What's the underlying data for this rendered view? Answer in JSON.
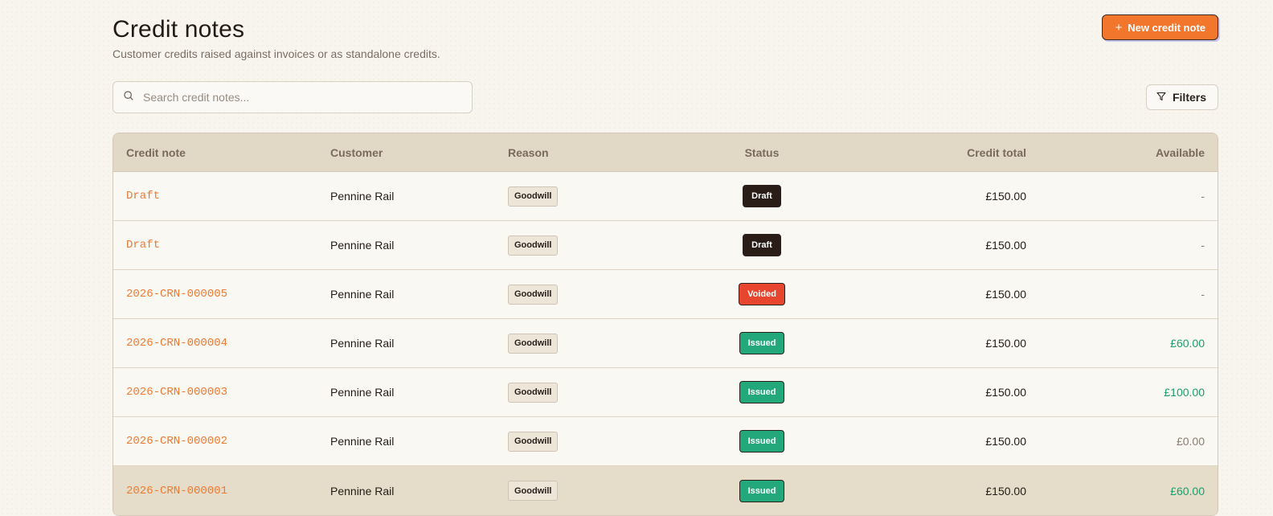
{
  "header": {
    "title": "Credit notes",
    "subtitle": "Customer credits raised against invoices or as standalone credits.",
    "new_button_label": "New credit note",
    "new_button_icon": "plus-icon"
  },
  "search": {
    "placeholder": "Search credit notes...",
    "value": "",
    "icon": "search-icon"
  },
  "filters": {
    "label": "Filters",
    "icon": "filter-icon"
  },
  "colors": {
    "accent": "#f2762b",
    "link": "#ee7a32",
    "draft": "#2a1d17",
    "voided": "#e8452f",
    "issued": "#22a87b",
    "available_positive": "#1a9e6e",
    "muted": "#8a7d72"
  },
  "table": {
    "headers": {
      "credit_note": "Credit note",
      "customer": "Customer",
      "reason": "Reason",
      "status": "Status",
      "credit_total": "Credit total",
      "available": "Available"
    },
    "rows": [
      {
        "credit_note": "Draft",
        "customer": "Pennine Rail",
        "reason": "Goodwill",
        "status": "Draft",
        "status_color": "#2a1d17",
        "credit_total": "£150.00",
        "available": "-",
        "available_color": "#8a7d72"
      },
      {
        "credit_note": "Draft",
        "customer": "Pennine Rail",
        "reason": "Goodwill",
        "status": "Draft",
        "status_color": "#2a1d17",
        "credit_total": "£150.00",
        "available": "-",
        "available_color": "#8a7d72"
      },
      {
        "credit_note": "2026-CRN-000005",
        "customer": "Pennine Rail",
        "reason": "Goodwill",
        "status": "Voided",
        "status_color": "#e8452f",
        "credit_total": "£150.00",
        "available": "-",
        "available_color": "#8a7d72"
      },
      {
        "credit_note": "2026-CRN-000004",
        "customer": "Pennine Rail",
        "reason": "Goodwill",
        "status": "Issued",
        "status_color": "#22a87b",
        "credit_total": "£150.00",
        "available": "£60.00",
        "available_color": "#1a9e6e"
      },
      {
        "credit_note": "2026-CRN-000003",
        "customer": "Pennine Rail",
        "reason": "Goodwill",
        "status": "Issued",
        "status_color": "#22a87b",
        "credit_total": "£150.00",
        "available": "£100.00",
        "available_color": "#1a9e6e"
      },
      {
        "credit_note": "2026-CRN-000002",
        "customer": "Pennine Rail",
        "reason": "Goodwill",
        "status": "Issued",
        "status_color": "#22a87b",
        "credit_total": "£150.00",
        "available": "£0.00",
        "available_color": "#8a7d72"
      },
      {
        "credit_note": "2026-CRN-000001",
        "customer": "Pennine Rail",
        "reason": "Goodwill",
        "status": "Issued",
        "status_color": "#22a87b",
        "credit_total": "£150.00",
        "available": "£60.00",
        "available_color": "#1a9e6e"
      }
    ]
  }
}
